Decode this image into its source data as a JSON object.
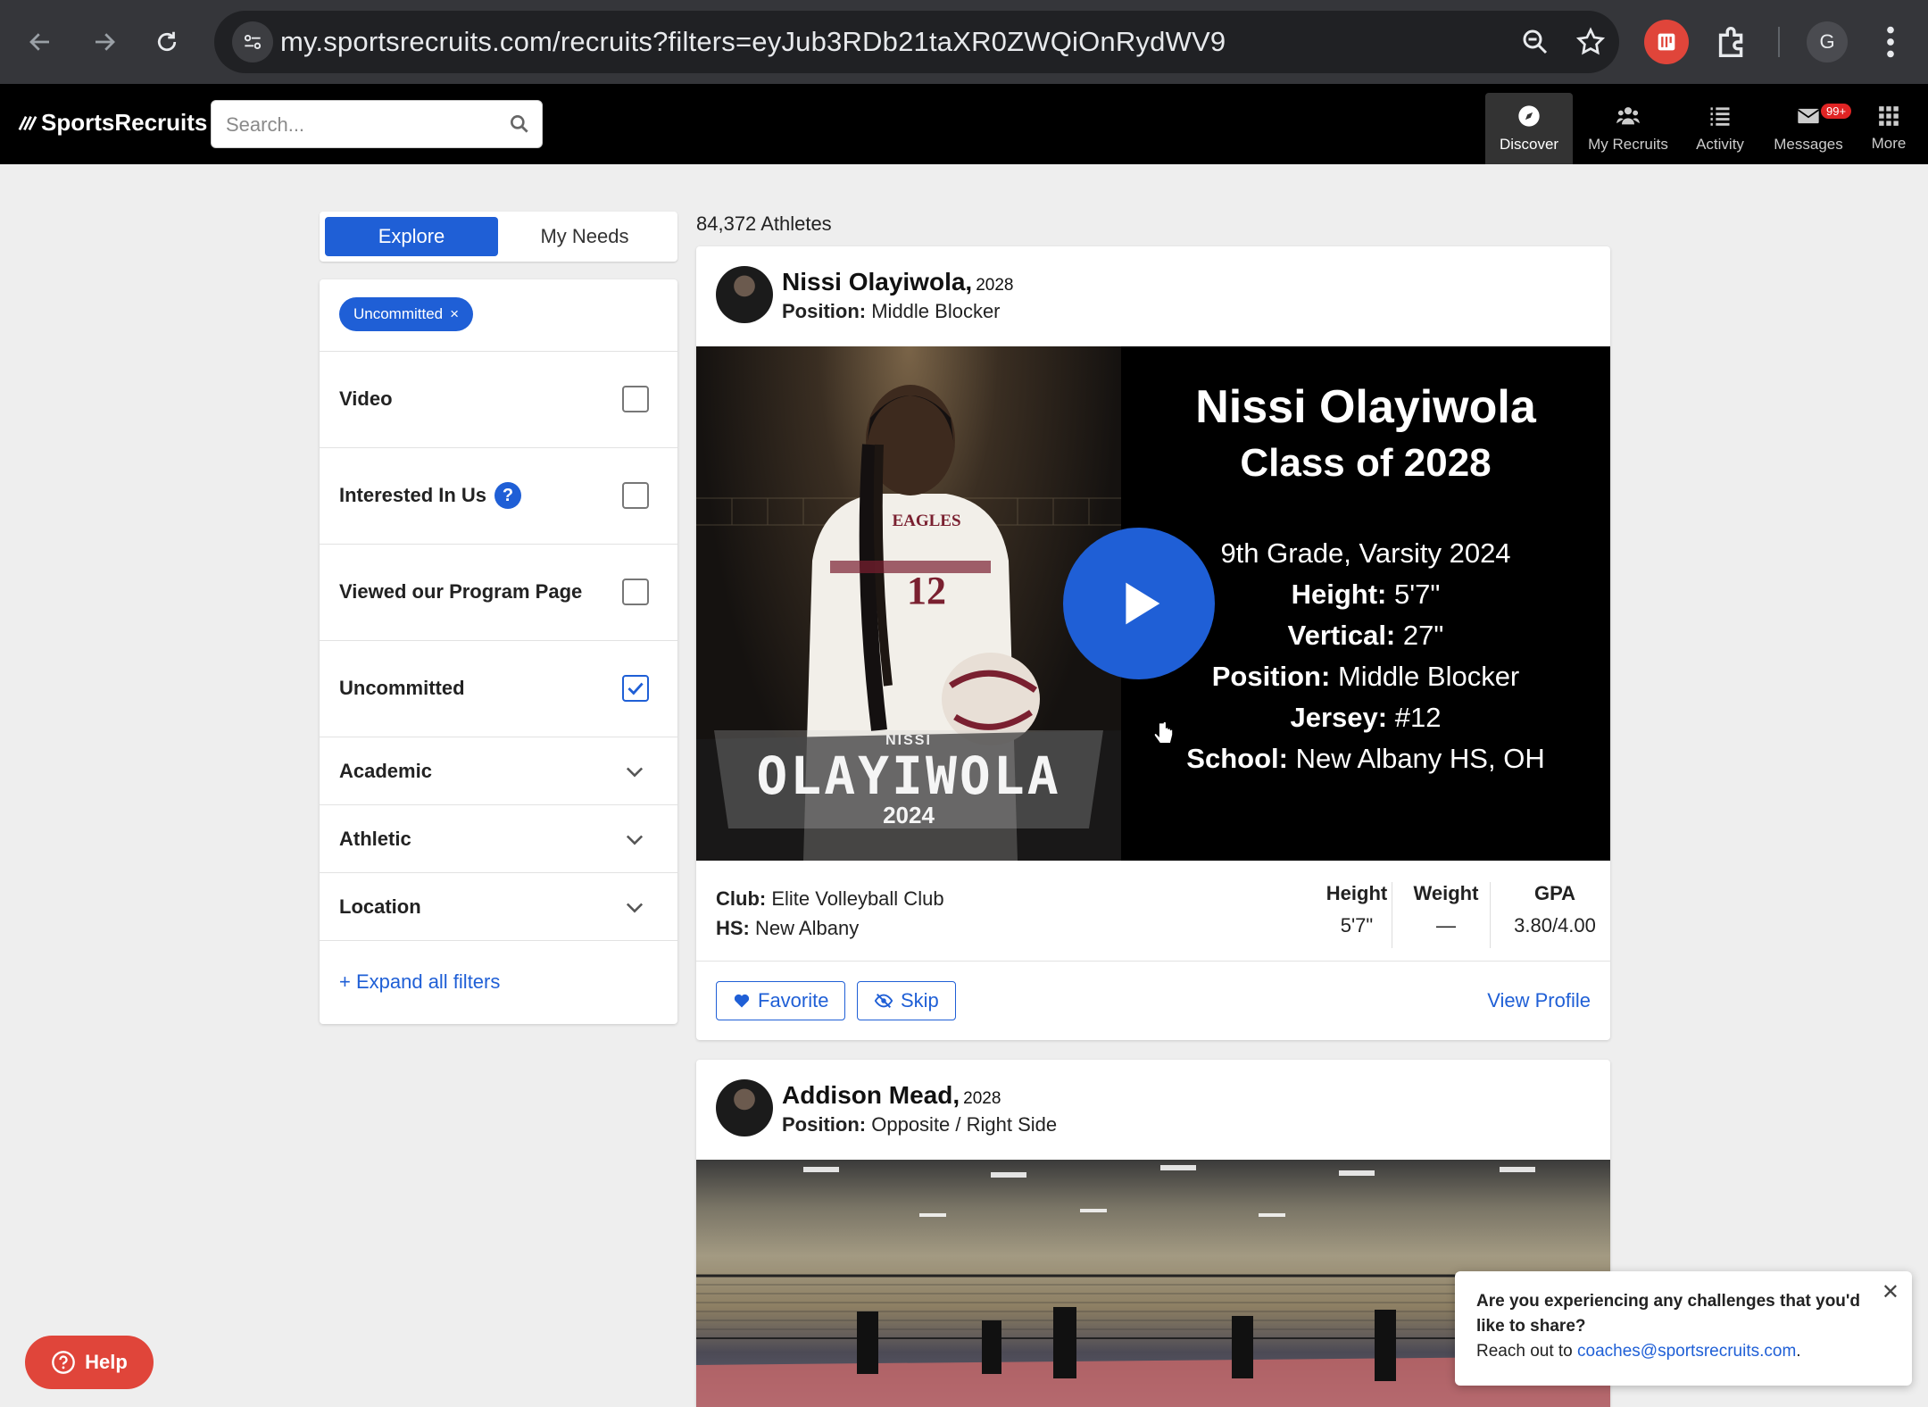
{
  "browser": {
    "url": "my.sportsrecruits.com/recruits?filters=eyJub3RDb21taXR0ZWQiOnRydWV9",
    "profile_initial": "G"
  },
  "header": {
    "logo_text": "SportsRecruits",
    "search_placeholder": "Search...",
    "nav": [
      {
        "label": "Discover",
        "icon": "compass-icon",
        "active": true
      },
      {
        "label": "My Recruits",
        "icon": "people-icon"
      },
      {
        "label": "Activity",
        "icon": "list-icon"
      },
      {
        "label": "Messages",
        "icon": "envelope-icon",
        "badge": "99+"
      },
      {
        "label": "More",
        "icon": "grid-icon"
      }
    ]
  },
  "sidebar": {
    "tabs": {
      "explore": "Explore",
      "my_needs": "My Needs"
    },
    "chip": {
      "label": "Uncommitted",
      "remove": "×"
    },
    "filters": [
      {
        "label": "Video",
        "checked": false
      },
      {
        "label": "Interested In Us",
        "checked": false,
        "help": "?"
      },
      {
        "label": "Viewed our Program Page",
        "checked": false
      },
      {
        "label": "Uncommitted",
        "checked": true
      }
    ],
    "sections": [
      "Academic",
      "Athletic",
      "Location"
    ],
    "expand_label": "+ Expand all filters"
  },
  "main": {
    "count": "84,372 Athletes",
    "athletes": [
      {
        "name": "Nissi Olayiwola,",
        "year": "2028",
        "position_label": "Position:",
        "position": "Middle Blocker",
        "video": {
          "title": "Nissi Olayiwola",
          "subtitle": "Class of 2028",
          "grade_line": "9th Grade, Varsity 2024",
          "lines": [
            {
              "k": "Height:",
              "v": "5'7\""
            },
            {
              "k": "Vertical:",
              "v": "27\""
            },
            {
              "k": "Position:",
              "v": "Middle Blocker"
            },
            {
              "k": "Jersey:",
              "v": "#12"
            },
            {
              "k": "School:",
              "v": "New Albany HS, OH"
            }
          ],
          "banner_small": "NISSI",
          "banner_name": "OLAYIWOLA",
          "banner_year": "2024",
          "jersey_text": "EAGLES",
          "jersey_number": "12"
        },
        "club_label": "Club:",
        "club": "Elite Volleyball Club",
        "hs_label": "HS:",
        "hs": "New Albany",
        "stats": [
          {
            "label": "Height",
            "value": "5'7\""
          },
          {
            "label": "Weight",
            "value": "—"
          },
          {
            "label": "GPA",
            "value": "3.80/4.00"
          }
        ],
        "actions": {
          "favorite": "Favorite",
          "skip": "Skip",
          "view": "View Profile"
        }
      },
      {
        "name": "Addison Mead,",
        "year": "2028",
        "position_label": "Position:",
        "position": "Opposite / Right Side"
      }
    ]
  },
  "help": {
    "label": "Help"
  },
  "toast": {
    "question": "Are you experiencing any challenges that you'd like to share?",
    "reach_prefix": "Reach out to",
    "email": "coaches@sportsrecruits.com",
    "reach_suffix": "."
  },
  "colors": {
    "brand_blue": "#1f5fd6",
    "help_red": "#e0453a",
    "badge_red": "#e02424"
  }
}
